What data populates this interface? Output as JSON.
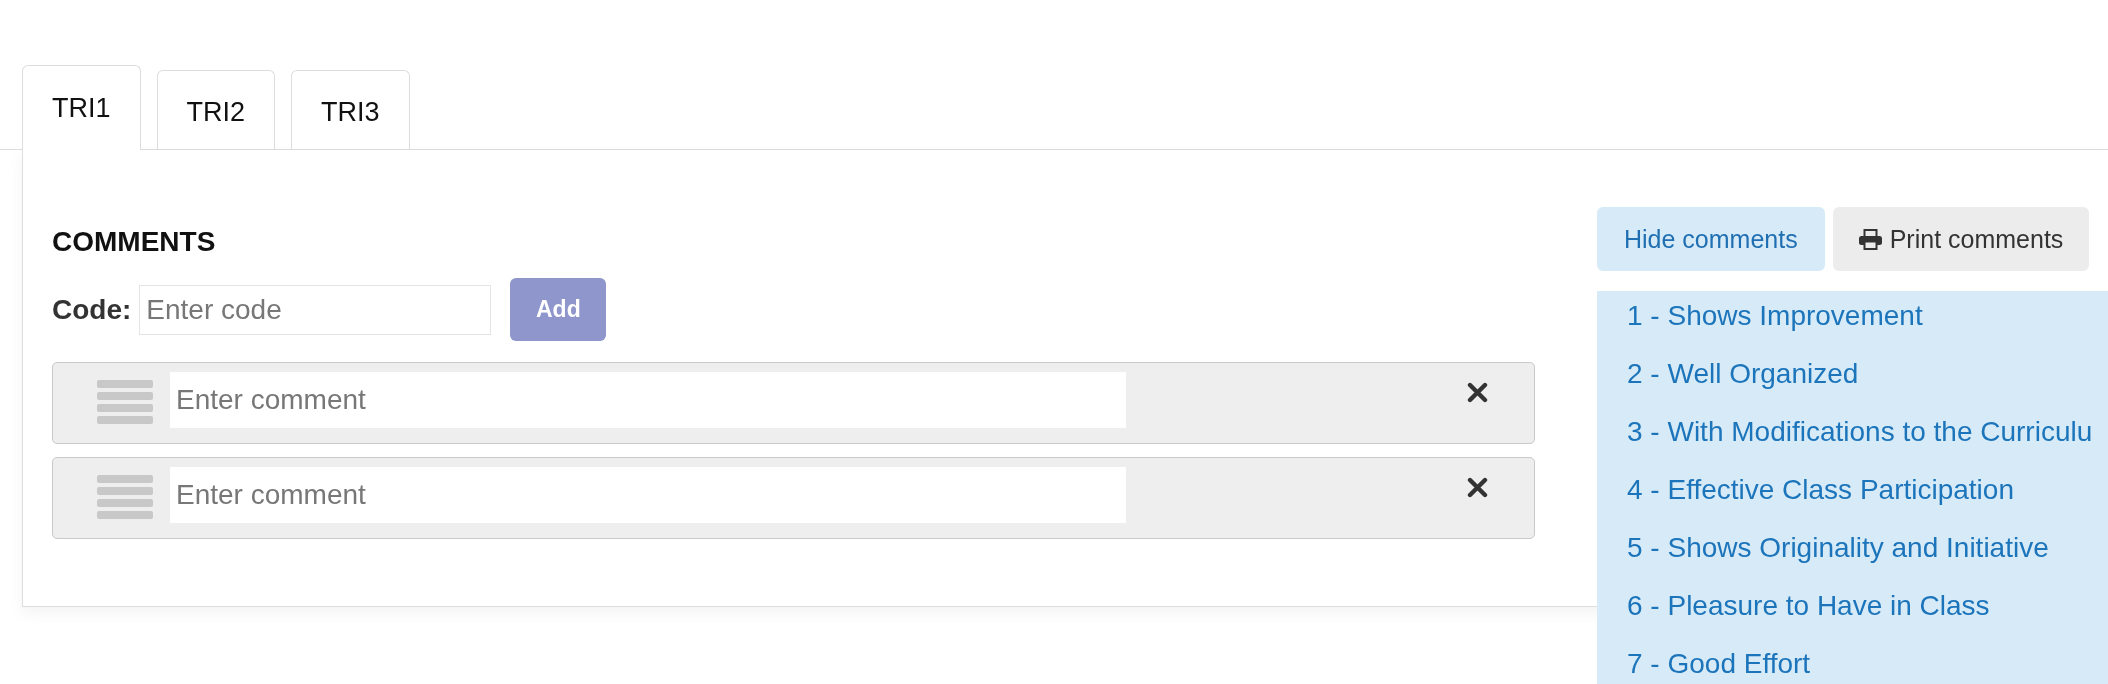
{
  "tabs": [
    {
      "label": "TRI1",
      "selected": true
    },
    {
      "label": "TRI2",
      "selected": false
    },
    {
      "label": "TRI3",
      "selected": false
    }
  ],
  "comments": {
    "heading": "COMMENTS",
    "code_label": "Code:",
    "code_field": {
      "placeholder": "Enter code"
    },
    "add_button": {
      "label": "Add",
      "disabled": true
    },
    "rows": [
      {
        "placeholder": "Enter comment"
      },
      {
        "placeholder": "Enter comment"
      }
    ]
  },
  "comment_bank": {
    "buttons": [
      {
        "kind": "toggle",
        "label": "Hide comments"
      },
      {
        "kind": "print",
        "label": "Print comments"
      }
    ],
    "items": [
      "1 - Shows Improvement",
      "2 - Well Organized",
      "3 - With Modifications to the Curriculu",
      "4 - Effective Class Participation",
      "5 - Shows Originality and Initiative",
      "6 - Pleasure to Have in Class",
      "7 - Good Effort"
    ]
  }
}
